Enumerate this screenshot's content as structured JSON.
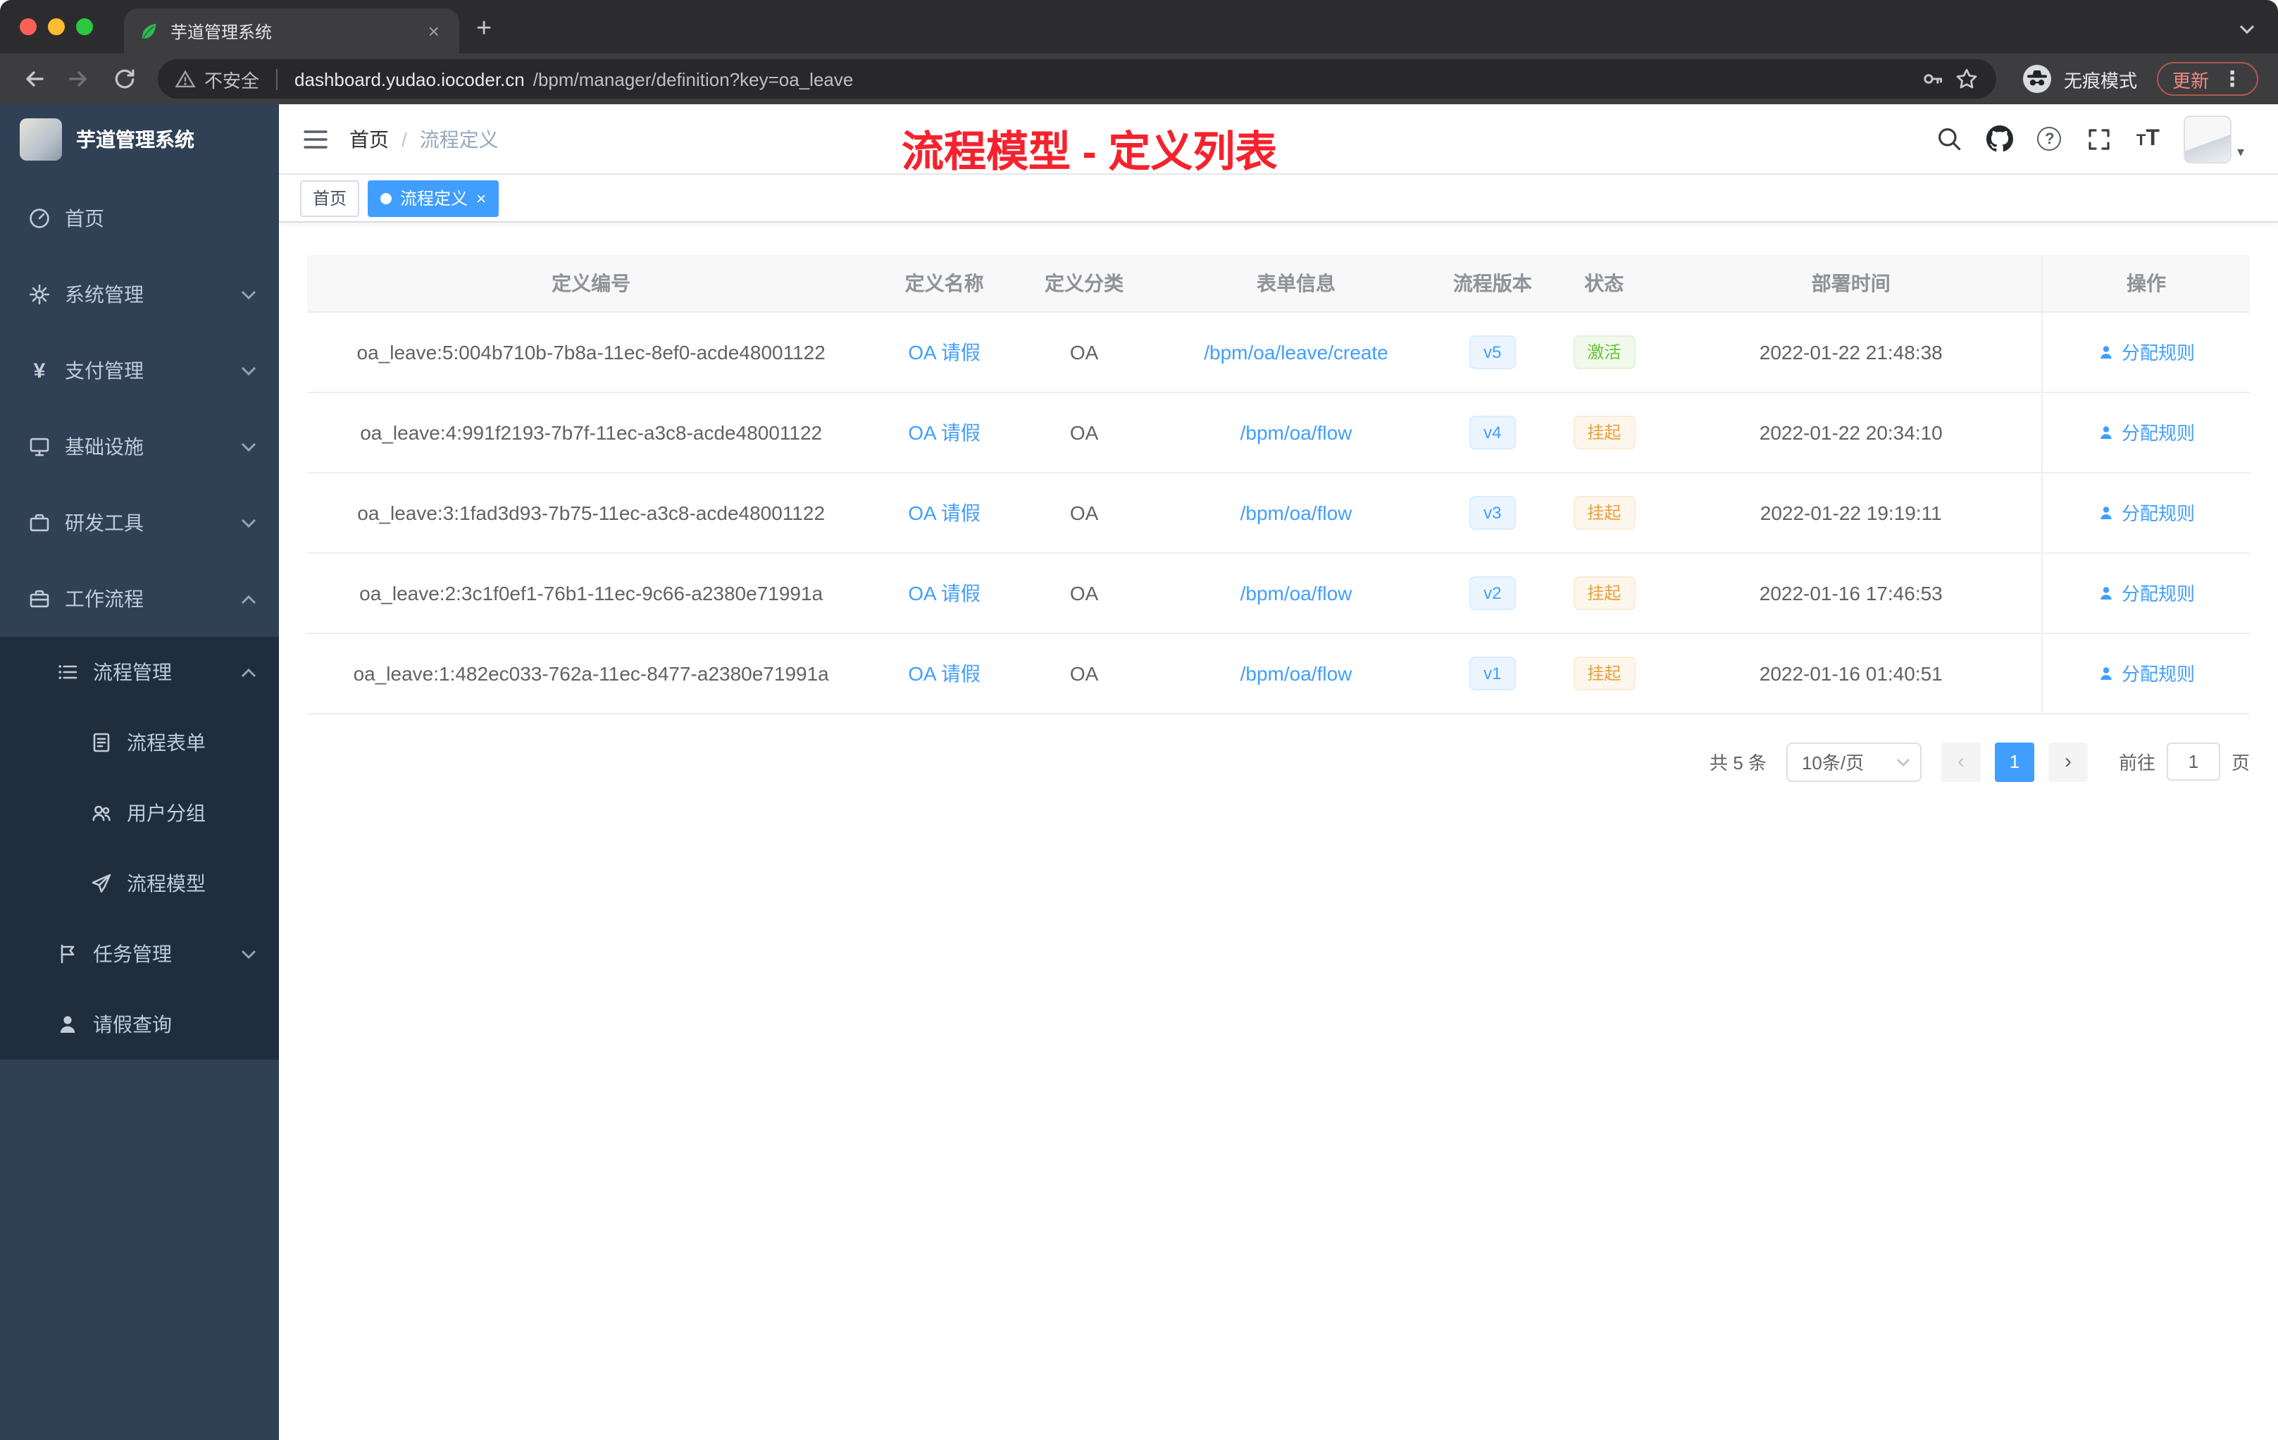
{
  "browser": {
    "tab_title": "芋道管理系统",
    "security_label": "不安全",
    "url_domain": "dashboard.yudao.iocoder.cn",
    "url_path": "/bpm/manager/definition?key=oa_leave",
    "incognito_label": "无痕模式",
    "update_label": "更新"
  },
  "sidebar": {
    "app_title": "芋道管理系统",
    "items": [
      {
        "label": "首页"
      },
      {
        "label": "系统管理"
      },
      {
        "label": "支付管理"
      },
      {
        "label": "基础设施"
      },
      {
        "label": "研发工具"
      },
      {
        "label": "工作流程"
      },
      {
        "label": "流程管理"
      },
      {
        "label": "流程表单"
      },
      {
        "label": "用户分组"
      },
      {
        "label": "流程模型"
      },
      {
        "label": "任务管理"
      },
      {
        "label": "请假查询"
      }
    ]
  },
  "header": {
    "breadcrumb_home": "首页",
    "breadcrumb_sep": "/",
    "breadcrumb_current": "流程定义",
    "annotation": "流程模型 - 定义列表"
  },
  "tags": {
    "home": "首页",
    "active": "流程定义"
  },
  "table": {
    "columns": [
      "定义编号",
      "定义名称",
      "定义分类",
      "表单信息",
      "流程版本",
      "状态",
      "部署时间",
      "操作"
    ],
    "action_label": "分配规则",
    "rows": [
      {
        "id": "oa_leave:5:004b710b-7b8a-11ec-8ef0-acde48001122",
        "name": "OA 请假",
        "category": "OA",
        "form": "/bpm/oa/leave/create",
        "version": "v5",
        "status": "激活",
        "time": "2022-01-22 21:48:38"
      },
      {
        "id": "oa_leave:4:991f2193-7b7f-11ec-a3c8-acde48001122",
        "name": "OA 请假",
        "category": "OA",
        "form": "/bpm/oa/flow",
        "version": "v4",
        "status": "挂起",
        "time": "2022-01-22 20:34:10"
      },
      {
        "id": "oa_leave:3:1fad3d93-7b75-11ec-a3c8-acde48001122",
        "name": "OA 请假",
        "category": "OA",
        "form": "/bpm/oa/flow",
        "version": "v3",
        "status": "挂起",
        "time": "2022-01-22 19:19:11"
      },
      {
        "id": "oa_leave:2:3c1f0ef1-76b1-11ec-9c66-a2380e71991a",
        "name": "OA 请假",
        "category": "OA",
        "form": "/bpm/oa/flow",
        "version": "v2",
        "status": "挂起",
        "time": "2022-01-16 17:46:53"
      },
      {
        "id": "oa_leave:1:482ec033-762a-11ec-8477-a2380e71991a",
        "name": "OA 请假",
        "category": "OA",
        "form": "/bpm/oa/flow",
        "version": "v1",
        "status": "挂起",
        "time": "2022-01-16 01:40:51"
      }
    ]
  },
  "pagination": {
    "total": "共 5 条",
    "page_size": "10条/页",
    "current_page": "1",
    "goto_label": "前往",
    "goto_value": "1",
    "page_unit": "页"
  },
  "colors": {
    "accent": "#409eff",
    "success": "#67c23a",
    "warning": "#e6a23c",
    "annotation_red": "#f5222d",
    "sidebar_bg": "#304156",
    "submenu_bg": "#1f2d3d"
  }
}
